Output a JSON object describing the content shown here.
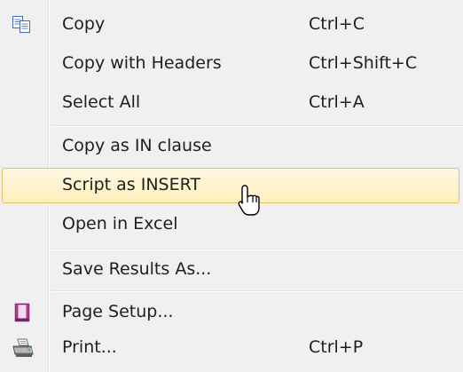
{
  "menu": {
    "items": [
      {
        "label": "Copy",
        "shortcut": "Ctrl+C",
        "icon": "copy-icon"
      },
      {
        "label": "Copy with Headers",
        "shortcut": "Ctrl+Shift+C"
      },
      {
        "label": "Select All",
        "shortcut": "Ctrl+A"
      },
      {
        "label": "Copy as IN clause",
        "shortcut": ""
      },
      {
        "label": "Script as INSERT",
        "shortcut": "",
        "state": "hovered"
      },
      {
        "label": "Open in Excel",
        "shortcut": ""
      },
      {
        "label": "Save Results As...",
        "shortcut": ""
      },
      {
        "label": "Page Setup...",
        "shortcut": "",
        "icon": "page-setup-icon"
      },
      {
        "label": "Print...",
        "shortcut": "Ctrl+P",
        "icon": "printer-icon"
      }
    ]
  },
  "colors": {
    "menu_background": "#f0f0f0",
    "hover_border": "#e5c365",
    "hover_fill": "#fff3cc",
    "separator": "#e2e3e3",
    "text": "#1e1e1e"
  },
  "cursor": {
    "icon": "mouse-pointer-icon"
  }
}
